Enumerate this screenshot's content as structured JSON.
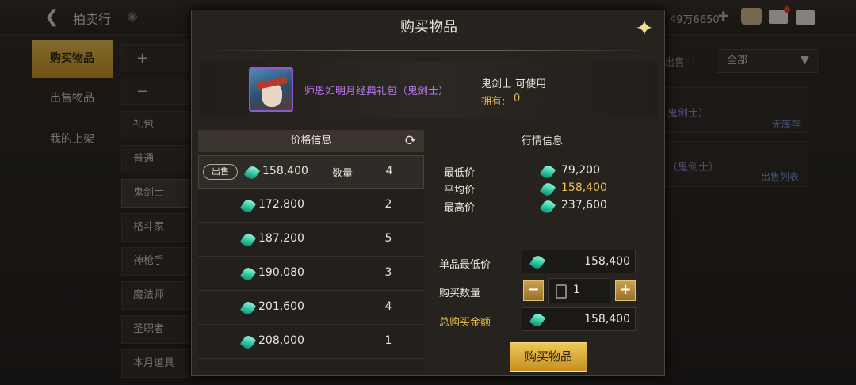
{
  "topbar": {
    "title": "拍卖行",
    "currency": "49万6650"
  },
  "side_tabs": [
    "购买物品",
    "出售物品",
    "我的上架"
  ],
  "sub_categories": [
    "礼包",
    "普通",
    "鬼剑士",
    "格斗家",
    "神枪手",
    "魔法师",
    "圣职者",
    "本月道具"
  ],
  "right_panel": {
    "status_label": "出售中",
    "filter_value": "全部",
    "row_labels": [
      "鬼剑士）",
      "（鬼剑士）"
    ],
    "row_statuses": [
      "无库存",
      "出售列表"
    ]
  },
  "modal": {
    "title": "购买物品",
    "item": {
      "name": "师恩如明月经典礼包（鬼剑士）",
      "usable": "鬼剑士 可使用",
      "own_label": "拥有:",
      "own_value": "0"
    },
    "price_info": {
      "header": "价格信息",
      "sell_badge": "出售",
      "qty_label": "数量",
      "rows": [
        {
          "price": "158,400",
          "qty": "4"
        },
        {
          "price": "172,800",
          "qty": "2"
        },
        {
          "price": "187,200",
          "qty": "5"
        },
        {
          "price": "190,080",
          "qty": "3"
        },
        {
          "price": "201,600",
          "qty": "4"
        },
        {
          "price": "208,000",
          "qty": "1"
        }
      ]
    },
    "market_info": {
      "header": "行情信息",
      "min_label": "最低价",
      "min_value": "79,200",
      "avg_label": "平均价",
      "avg_value": "158,400",
      "max_label": "最高价",
      "max_value": "237,600"
    },
    "purchase": {
      "unit_price_label": "单品最低价",
      "unit_price_value": "158,400",
      "qty_label": "购买数量",
      "qty_value": "1",
      "qty_minus": "−",
      "qty_plus": "+",
      "total_label": "总购买金额",
      "total_value": "158,400",
      "buy_button": "购买物品"
    }
  },
  "colors": {
    "gold": "#f0bf4c",
    "item_purple": "#b676e8",
    "gem_green": "#2fc7a0"
  }
}
